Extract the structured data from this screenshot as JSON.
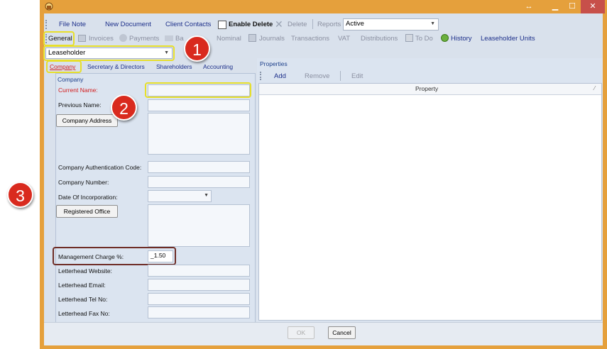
{
  "window": {
    "title_icon": "app-icon",
    "resize_glyph": "↔",
    "min_glyph": "▁",
    "max_glyph": "☐",
    "close_glyph": "✕"
  },
  "toolbar": {
    "file_note": "File Note",
    "new_document": "New Document",
    "client_contacts": "Client Contacts",
    "enable_delete": "Enable Delete",
    "delete": "Delete",
    "reports": "Reports",
    "reports_value": "Active"
  },
  "tabs": {
    "general": "General",
    "invoices": "Invoices",
    "payments": "Payments",
    "bank": "Ba",
    "nominal": "Nominal",
    "journals": "Journals",
    "transactions": "Transactions",
    "vat": "VAT",
    "distributions": "Distributions",
    "todo": "To Do",
    "history": "History",
    "leaseholder_units": "Leaseholder Units"
  },
  "selector": {
    "value": "Leaseholder"
  },
  "subtabs": {
    "company": "Company",
    "secretary": "Secretary & Directors",
    "shareholders": "Shareholders",
    "accounting": "Accounting"
  },
  "company": {
    "group_title": "Company",
    "current_name": "Current Name:",
    "previous_name": "Previous Name:",
    "company_address": "Company Address",
    "auth_code": "Company Authentication Code:",
    "company_number": "Company Number:",
    "date_incorporation": "Date Of Incorporation:",
    "registered_office": "Registered Office",
    "management_charge": "Management Charge %:",
    "management_charge_value": "_1.50",
    "letterhead_website": "Letterhead Website:",
    "letterhead_email": "Letterhead Email:",
    "letterhead_tel": "Letterhead Tel No:",
    "letterhead_fax": "Letterhead Fax No:"
  },
  "properties": {
    "title": "Properties",
    "add": "Add",
    "remove": "Remove",
    "edit": "Edit",
    "column": "Property"
  },
  "footer": {
    "ok": "OK",
    "cancel": "Cancel"
  },
  "annotations": {
    "one": "1",
    "two": "2",
    "three": "3"
  },
  "colors": {
    "frame": "#e5a03c",
    "highlight": "#e7df2a",
    "badge": "#d92a1e"
  }
}
